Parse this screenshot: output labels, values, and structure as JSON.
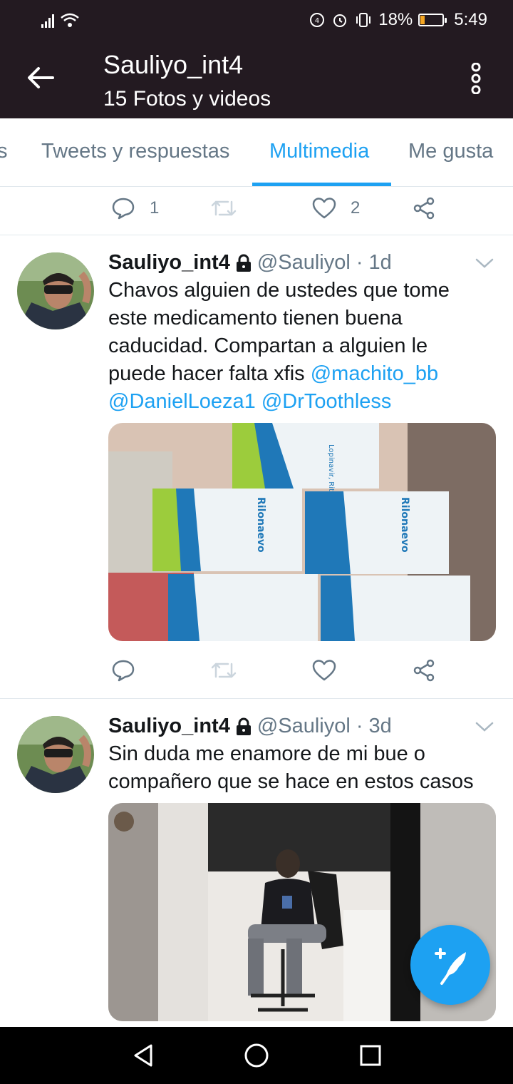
{
  "status": {
    "battery": "18%",
    "time": "5:49",
    "battery_color": "#f5a623"
  },
  "header": {
    "title": "Sauliyo_int4",
    "subtitle": "15 Fotos y videos",
    "bg": "#231a21"
  },
  "tabs": [
    {
      "label": "s"
    },
    {
      "label": "Tweets y respuestas"
    },
    {
      "label": "Multimedia",
      "active": true
    },
    {
      "label": "Me gusta"
    }
  ],
  "accent": "#1da1f2",
  "prev_tweet_actions": {
    "replies": "1",
    "likes": "2"
  },
  "tweets": [
    {
      "name": "Sauliyo_int4",
      "handle": "@Sauliyol",
      "time": "· 1d",
      "text_lines": [
        "Chavos alguien de ustedes que tome",
        "este medicamento tienen buena",
        "caducidad. Compartan a alguien le",
        "puede hacer falta xfis "
      ],
      "mentions": [
        "@machito_bb",
        "@DanielLoeza1",
        "@DrToothless"
      ],
      "media_boxes": [
        {
          "brand": "Rilonaevo",
          "drug": "Lopinavir, Ritonavir"
        }
      ]
    },
    {
      "name": "Sauliyo_int4",
      "handle": "@Sauliyol",
      "time": "· 3d",
      "text_lines": [
        "Sin duda me enamore de mi bue o",
        "compañero que se hace en estos casos"
      ]
    }
  ]
}
